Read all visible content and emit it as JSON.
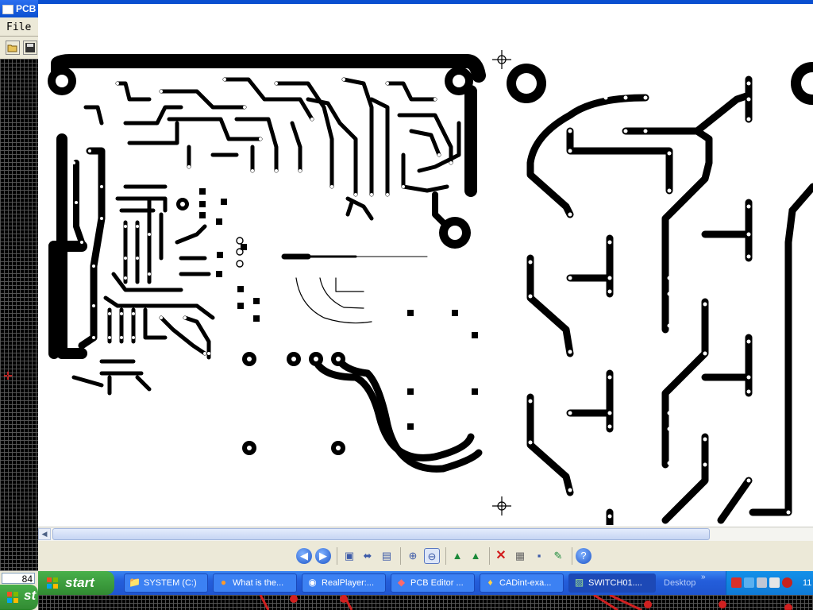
{
  "pcb_window": {
    "title": "PCB",
    "menu_file": "File",
    "coordinate": "84"
  },
  "viewer_toolbar": {
    "icons": [
      "previous-icon",
      "next-icon",
      "fit-page-icon",
      "fit-width-icon",
      "actual-size-icon",
      "zoom-in-icon",
      "zoom-out-icon",
      "rotate-left-icon",
      "rotate-right-icon",
      "delete-icon",
      "print-icon",
      "save-icon",
      "edit-icon",
      "help-icon"
    ]
  },
  "taskbar": {
    "start_label": "start",
    "items": [
      {
        "label": "SYSTEM (C:)",
        "icon": "folder-icon"
      },
      {
        "label": "What is the...",
        "icon": "firefox-icon"
      },
      {
        "label": "RealPlayer:...",
        "icon": "realplayer-icon"
      },
      {
        "label": "PCB Editor ...",
        "icon": "pcb-editor-icon"
      },
      {
        "label": "CADint-exa...",
        "icon": "cadint-icon"
      },
      {
        "label": "SWITCH01....",
        "icon": "picture-viewer-icon"
      }
    ],
    "desktop_label": "Desktop",
    "clock": "11"
  },
  "taskbar2": {
    "start_label": "st"
  },
  "colors": {
    "xp_blue": "#245edb",
    "start_green": "#3c9a3e",
    "tray_blue": "#0f7ad6",
    "pcb_trace": "#000000"
  }
}
